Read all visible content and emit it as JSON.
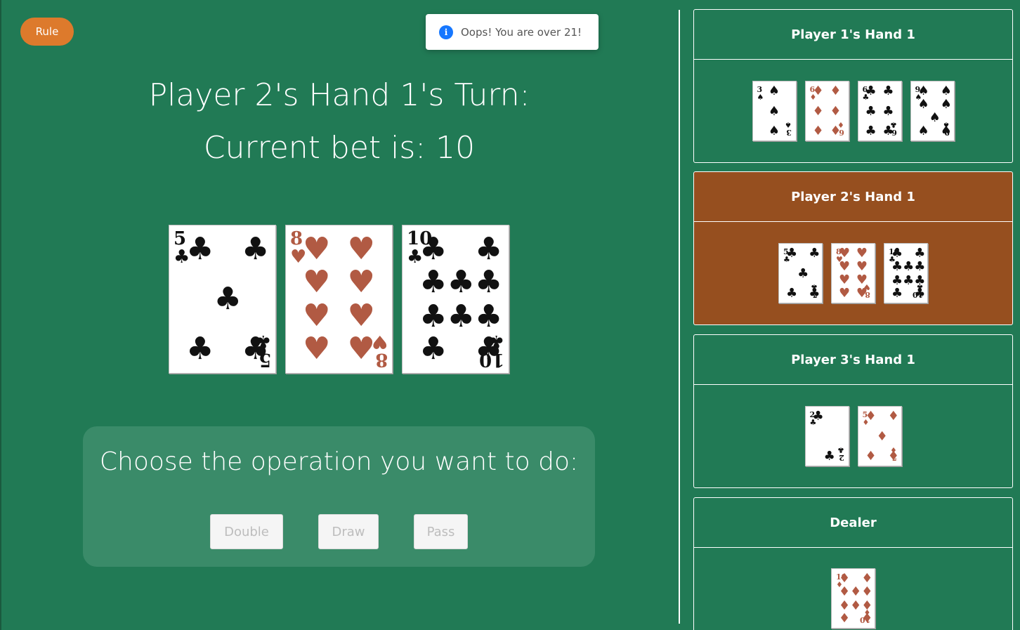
{
  "rule_button": "Rule",
  "toast": {
    "icon": "i",
    "message": "Oops! You are over 21!"
  },
  "turn": {
    "line1": "Player 2's Hand 1's Turn:",
    "line2": "Current bet is: 10"
  },
  "current_hand": [
    {
      "rank": "5",
      "suit": "♣",
      "color": "black"
    },
    {
      "rank": "8",
      "suit": "♥",
      "color": "red"
    },
    {
      "rank": "10",
      "suit": "♣",
      "color": "black"
    }
  ],
  "operations": {
    "title": "Choose the operation you want to do:",
    "double": "Double",
    "draw": "Draw",
    "pass": "Pass"
  },
  "hands": [
    {
      "title": "Player 1's Hand 1",
      "active": false,
      "cards": [
        {
          "rank": "3",
          "suit": "♠",
          "color": "black"
        },
        {
          "rank": "6",
          "suit": "♦",
          "color": "red"
        },
        {
          "rank": "6",
          "suit": "♣",
          "color": "black"
        },
        {
          "rank": "9",
          "suit": "♠",
          "color": "black"
        }
      ]
    },
    {
      "title": "Player 2's Hand 1",
      "active": true,
      "cards": [
        {
          "rank": "5",
          "suit": "♣",
          "color": "black"
        },
        {
          "rank": "8",
          "suit": "♥",
          "color": "red"
        },
        {
          "rank": "10",
          "suit": "♣",
          "color": "black"
        }
      ]
    },
    {
      "title": "Player 3's Hand 1",
      "active": false,
      "cards": [
        {
          "rank": "2",
          "suit": "♣",
          "color": "black"
        },
        {
          "rank": "5",
          "suit": "♦",
          "color": "red"
        }
      ]
    },
    {
      "title": "Dealer",
      "active": false,
      "cards": [
        {
          "rank": "10",
          "suit": "♦",
          "color": "red"
        }
      ]
    }
  ],
  "colors": {
    "table": "#217a55",
    "panel": "#3a8b69",
    "active_hand": "#964f1f",
    "rule_button": "#dd7a2c",
    "red_suit": "#b15a43"
  }
}
